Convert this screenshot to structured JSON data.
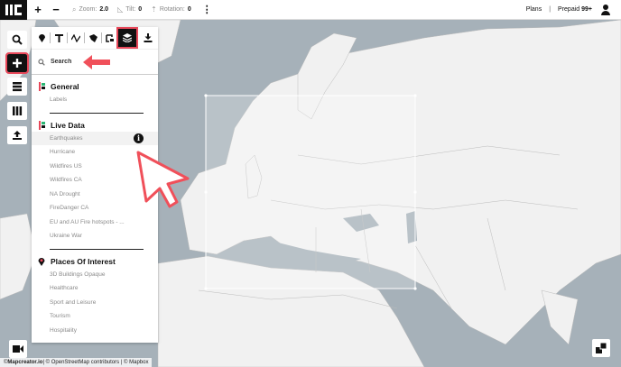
{
  "topbar": {
    "zoom_label": "Zoom:",
    "zoom_value": "2.0",
    "tilt_label": "Tilt:",
    "tilt_value": "0",
    "rotation_label": "Rotation:",
    "rotation_value": "0",
    "plans_label": "Plans",
    "separator": "|",
    "prepaid_label": "Prepaid",
    "prepaid_count": "99+"
  },
  "panel": {
    "search_placeholder": "Search",
    "sections": [
      {
        "title": "General",
        "items": [
          "Labels"
        ]
      },
      {
        "title": "Live Data",
        "items": [
          "Earthquakes",
          "Hurricane",
          "Wildfires US",
          "Wildfires CA",
          "NA Drought",
          "FireDanger CA",
          "EU and AU Fire hotspots - ...",
          "Ukraine War"
        ]
      },
      {
        "title": "Places Of Interest",
        "items": [
          "3D Buildings Opaque",
          "Healthcare",
          "Sport and Leisure",
          "Tourism",
          "Hospitality"
        ]
      }
    ],
    "info_glyph": "i"
  },
  "attribution": {
    "prefix": "© ",
    "brand": "Mapcreator.io",
    "rest": " | © OpenStreetMap contributors | © Mapbox"
  },
  "colors": {
    "accent": "#e8485a",
    "water": "#a6b1b9",
    "land": "#f1f1f1"
  },
  "icons": [
    "logo",
    "plus-icon",
    "minus-icon",
    "tilt-icon",
    "rotation-icon",
    "more-icon",
    "user-icon",
    "search-icon",
    "add-icon",
    "layers-list-icon",
    "library-icon",
    "upload-icon",
    "marker-icon",
    "text-icon",
    "line-icon",
    "polygon-icon",
    "frame-icon",
    "layers-icon",
    "download-icon",
    "video-icon",
    "minimap-icon",
    "arrow-pointer",
    "cursor-pointer"
  ]
}
